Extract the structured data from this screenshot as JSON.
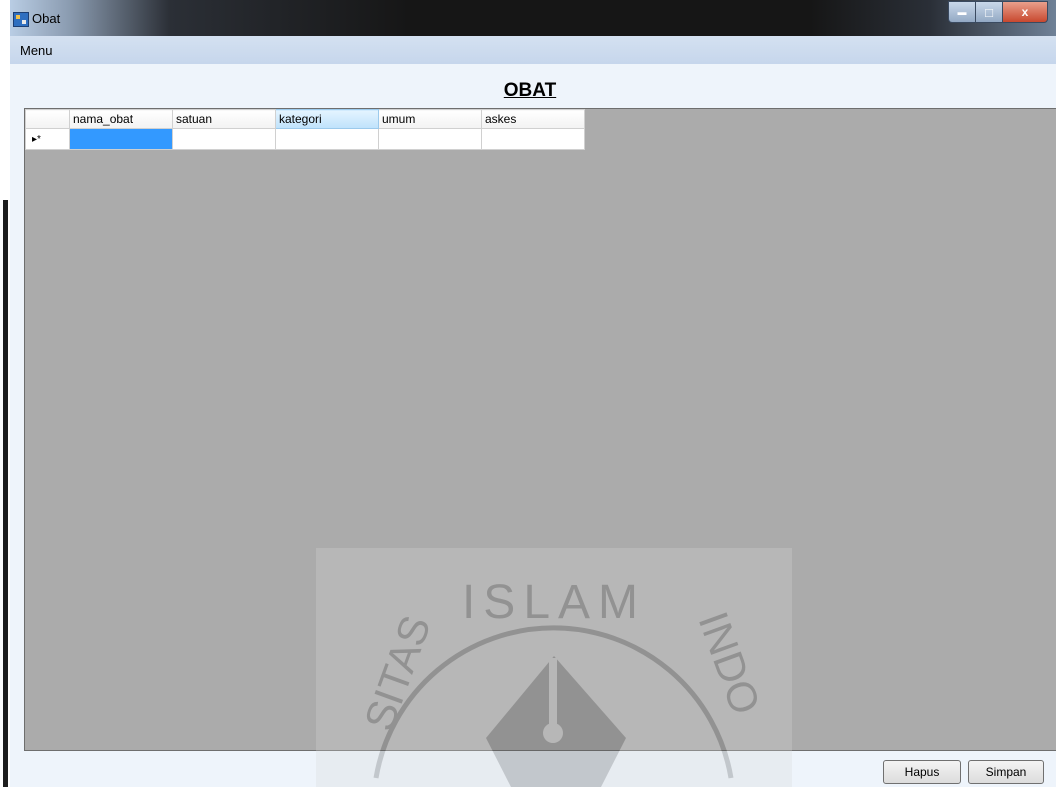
{
  "window": {
    "title": "Obat",
    "min_glyph": "▬",
    "max_glyph": "□",
    "close_glyph": "x"
  },
  "menu": {
    "items": [
      {
        "label": "Menu"
      }
    ]
  },
  "form": {
    "heading": "OBAT"
  },
  "grid": {
    "columns": [
      "nama_obat",
      "satuan",
      "kategori",
      "umum",
      "askes"
    ],
    "selected_column": "kategori",
    "new_row_marker": "▸*",
    "rows": [
      [
        "",
        "",
        "",
        "",
        ""
      ]
    ]
  },
  "buttons": {
    "delete": "Hapus",
    "save": "Simpan"
  },
  "watermark": {
    "text": "ISLAM",
    "left_letters": "SITAS",
    "right_letters": "INDO"
  },
  "colors": {
    "grid_background": "#ababab",
    "current_cell": "#3399ff",
    "menubar": "#c6d6ec"
  },
  "icons": [
    "app-icon",
    "minimize-icon",
    "maximize-icon",
    "close-icon",
    "new-row-icon"
  ]
}
